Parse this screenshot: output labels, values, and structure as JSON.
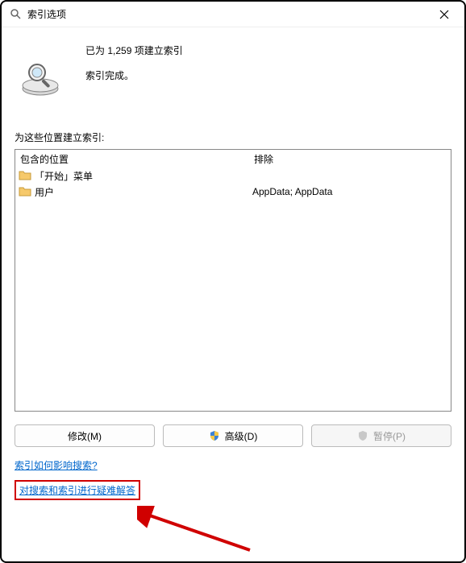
{
  "titlebar": {
    "title": "索引选项"
  },
  "status": {
    "count_line": "已为 1,259 项建立索引",
    "status_line": "索引完成。"
  },
  "section": {
    "label": "为这些位置建立索引:"
  },
  "list": {
    "header_included": "包含的位置",
    "header_excluded": "排除",
    "rows": [
      {
        "included": "「开始」菜单",
        "excluded": ""
      },
      {
        "included": "用户",
        "excluded": "AppData; AppData"
      }
    ]
  },
  "buttons": {
    "modify": "修改(M)",
    "advanced": "高级(D)",
    "pause": "暂停(P)"
  },
  "links": {
    "how_affects": "索引如何影响搜索?",
    "troubleshoot": "对搜索和索引进行疑难解答"
  }
}
